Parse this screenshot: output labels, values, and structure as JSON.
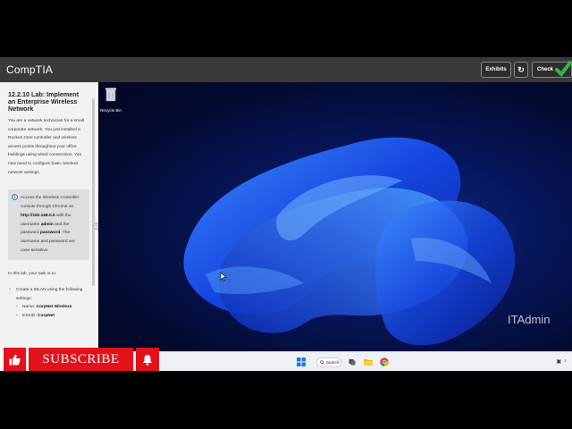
{
  "app": {
    "logo": "CompTIA",
    "buttons": {
      "exhibits": "Exhibits",
      "refresh_icon": "refresh-icon",
      "check": "Check"
    }
  },
  "lab": {
    "title": "12.2.10 Lab: Implement an Enterprise Wireless Network",
    "description": "You are a network technician for a small corporate network. You just installed a Ruckus zone controller and wireless access points throughout your office buildings using wired connections. You now need to configure basic wireless network settings.",
    "note": {
      "line1": "Access the Wireless Controller console through Chrome on",
      "url": "http://192.168.0.6",
      "line2": "with the username",
      "username": "admin",
      "line3": "and the password",
      "password": "password",
      "line4": ". The username and password are case-sensitive."
    },
    "task_intro": "In this lab, your task is to:",
    "tasks": [
      {
        "text": "Create a WLAN using the following settings:",
        "subs": [
          {
            "label": "Name:",
            "value": "CorpNet Wireless"
          },
          {
            "label": "ESSID:",
            "value": "CorpNet"
          }
        ]
      }
    ]
  },
  "desktop": {
    "recycle_bin": "Recycle Bin",
    "watermark": "ITAdmin"
  },
  "taskbar": {
    "search_label": "Search",
    "colors": {
      "start": "#1f7ae0",
      "explorer": "#f2b705",
      "chrome_red": "#db4437",
      "chrome_green": "#0f9d58",
      "chrome_yellow": "#f4b400",
      "chrome_blue": "#4285f4"
    }
  },
  "overlay": {
    "subscribe": "SUBSCRIBE",
    "like_icon": "thumbs-up-icon",
    "bell_icon": "bell-icon",
    "accent": "#e3111b"
  }
}
